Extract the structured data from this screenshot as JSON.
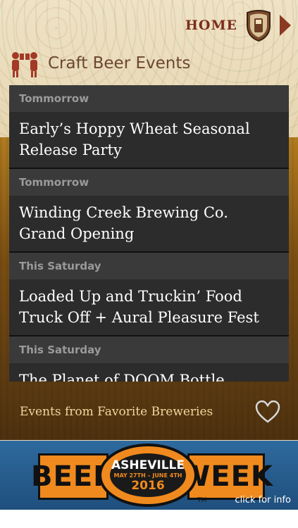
{
  "header": {
    "home_label": "HOME",
    "title": "Craft Beer Events"
  },
  "events": [
    {
      "date": "Tommorrow",
      "line1": "Early’s Hoppy Wheat Seasonal",
      "line2": "Release Party"
    },
    {
      "date": "Tommorrow",
      "line1": "Winding Creek Brewing Co.",
      "line2": "Grand Opening"
    },
    {
      "date": "This Saturday",
      "line1": "Loaded Up and Truckin’ Food",
      "line2": "Truck Off + Aural Pleasure Fest"
    },
    {
      "date": "This Saturday",
      "line1": "The Planet of DOOM Bottle",
      "line2": ""
    }
  ],
  "favorites": {
    "label": "Events from Favorite Breweries"
  },
  "banner": {
    "beer": "BEER",
    "week": "WEEK",
    "city": "ASHEVILLE",
    "dates": "MAY 27TH – JUNE 4TH",
    "year": "2016",
    "tm": "TM",
    "cta": "click for info"
  },
  "colors": {
    "accent_red": "#7b2d1c",
    "banner_orange": "#f08a1e",
    "banner_blue": "#2e6a9e"
  },
  "icons": [
    "beer-glass-shield-icon",
    "arrow-right-icon",
    "people-cheers-icon",
    "heart-icon"
  ]
}
